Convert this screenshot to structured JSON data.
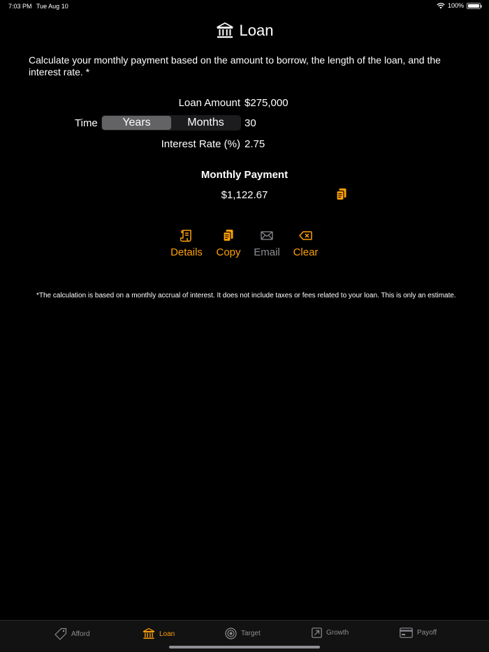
{
  "status_bar": {
    "time": "7:03 PM",
    "date": "Tue Aug 10",
    "battery": "100%"
  },
  "header": {
    "title": "Loan",
    "icon": "bank-icon"
  },
  "intro_text": "Calculate your monthly payment based on the amount to borrow, the length of the loan, and the interest rate. *",
  "form": {
    "loan_amount_label": "Loan Amount",
    "loan_amount_value": "$275,000",
    "time_label": "Time",
    "time_options": [
      "Years",
      "Months"
    ],
    "time_selected": "Years",
    "time_value": "30",
    "interest_label": "Interest Rate (%)",
    "interest_value": "2.75"
  },
  "result": {
    "title": "Monthly Payment",
    "value": "$1,122.67"
  },
  "actions": [
    {
      "label": "Details",
      "icon": "scroll-icon",
      "enabled": true
    },
    {
      "label": "Copy",
      "icon": "copy-icon",
      "enabled": true
    },
    {
      "label": "Email",
      "icon": "envelope-icon",
      "enabled": false
    },
    {
      "label": "Clear",
      "icon": "delete-left-icon",
      "enabled": true
    }
  ],
  "footnote": "*The calculation is based on a monthly accrual of interest.  It does not include taxes or fees related to your loan.  This is only an estimate.",
  "tabs": [
    {
      "label": "Afford",
      "icon": "tag-icon",
      "selected": false
    },
    {
      "label": "Loan",
      "icon": "bank-icon",
      "selected": true
    },
    {
      "label": "Target",
      "icon": "target-icon",
      "selected": false
    },
    {
      "label": "Growth",
      "icon": "arrow-up-right-square-icon",
      "selected": false
    },
    {
      "label": "Payoff",
      "icon": "credit-card-icon",
      "selected": false
    }
  ],
  "colors": {
    "accent": "#ff9f0a",
    "background": "#000000",
    "disabled": "#8e8e93"
  }
}
